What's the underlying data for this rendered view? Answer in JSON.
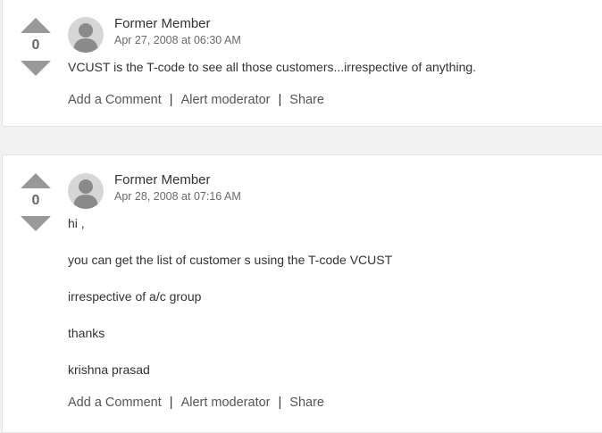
{
  "answers": [
    {
      "votes": "0",
      "author": "Former Member",
      "date": "Apr 27, 2008 at 06:30 AM",
      "body": [
        "VCUST is the T-code to see all those customers...irrespective of anything."
      ],
      "actions": {
        "comment": "Add a Comment",
        "alert": "Alert moderator",
        "share": "Share",
        "separator": "|"
      }
    },
    {
      "votes": "0",
      "author": "Former Member",
      "date": "Apr 28, 2008 at 07:16 AM",
      "body": [
        "hi ,",
        "you can get the list of customer s using the T-code VCUST",
        "irrespective of a/c group",
        "thanks",
        "krishna prasad"
      ],
      "actions": {
        "comment": "Add a Comment",
        "alert": "Alert moderator",
        "share": "Share",
        "separator": "|"
      }
    }
  ],
  "colors": {
    "vote_arrow": "#999999",
    "avatar_bg": "#d6d6d6",
    "avatar_figure": "#8a8a8a"
  },
  "icons": {
    "vote_up": "triangle-up",
    "vote_down": "triangle-down",
    "avatar": "person-silhouette"
  }
}
